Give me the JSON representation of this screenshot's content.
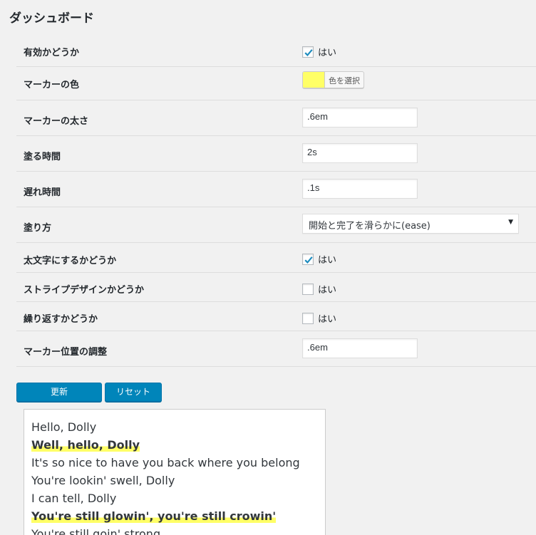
{
  "page_title": "ダッシュボード",
  "colors": {
    "marker": "#ffff66",
    "primary_button": "#0085ba"
  },
  "settings": {
    "enabled": {
      "label": "有効かどうか",
      "checked": true,
      "option_label": "はい"
    },
    "marker_color": {
      "label": "マーカーの色",
      "button_label": "色を選択",
      "value": "#ffff66"
    },
    "marker_thickness": {
      "label": "マーカーの太さ",
      "value": ".6em"
    },
    "paint_duration": {
      "label": "塗る時間",
      "value": "2s"
    },
    "delay": {
      "label": "遅れ時間",
      "value": ".1s"
    },
    "easing": {
      "label": "塗り方",
      "selected": "開始と完了を滑らかに(ease)"
    },
    "bold": {
      "label": "太文字にするかどうか",
      "checked": true,
      "option_label": "はい"
    },
    "stripe": {
      "label": "ストライプデザインかどうか",
      "checked": false,
      "option_label": "はい"
    },
    "repeat": {
      "label": "繰り返すかどうか",
      "checked": false,
      "option_label": "はい"
    },
    "position": {
      "label": "マーカー位置の調整",
      "value": ".6em"
    }
  },
  "buttons": {
    "update": "更新",
    "reset": "リセット"
  },
  "preview": {
    "lines": [
      {
        "text": "Hello, Dolly",
        "marked": false
      },
      {
        "text": "Well, hello, Dolly",
        "marked": true
      },
      {
        "text": "It's so nice to have you back where you belong",
        "marked": false
      },
      {
        "text": "You're lookin' swell, Dolly",
        "marked": false
      },
      {
        "text": "I can tell, Dolly",
        "marked": false
      },
      {
        "text": "You're still glowin', you're still crowin'",
        "marked": true
      },
      {
        "text": "You're still goin' strong",
        "marked": false
      }
    ]
  }
}
